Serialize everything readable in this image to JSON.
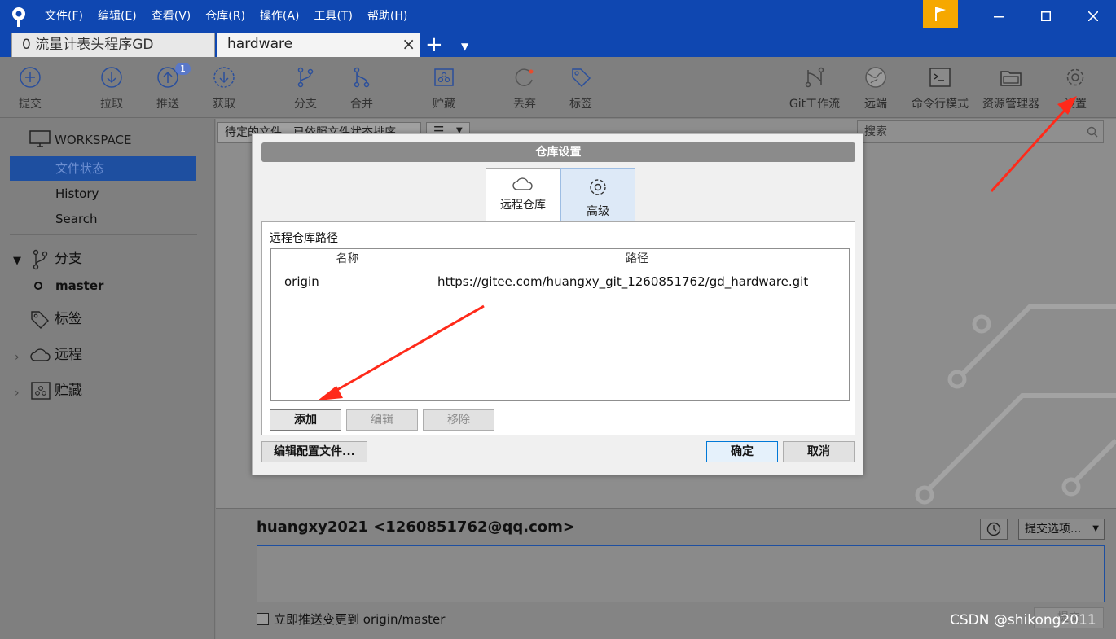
{
  "menus": [
    "文件(F)",
    "编辑(E)",
    "查看(V)",
    "仓库(R)",
    "操作(A)",
    "工具(T)",
    "帮助(H)"
  ],
  "tabs": [
    {
      "label": "0 流量计表头程序GD"
    },
    {
      "label": "hardware"
    }
  ],
  "toolbar": {
    "commit": "提交",
    "pull": "拉取",
    "push": "推送",
    "push_badge": "1",
    "fetch": "获取",
    "branch": "分支",
    "merge": "合并",
    "stash": "贮藏",
    "discard": "丢弃",
    "tag": "标签",
    "gitflow": "Git工作流",
    "remote": "远端",
    "terminal": "命令行模式",
    "explorer": "资源管理器",
    "settings": "设置"
  },
  "sidebar": {
    "workspace": "WORKSPACE",
    "file_status": "文件状态",
    "history": "History",
    "search": "Search",
    "branches": "分支",
    "master": "master",
    "tags": "标签",
    "remotes": "远程",
    "stashes": "贮藏"
  },
  "main": {
    "filter": "待定的文件，已依照文件状态排序",
    "search_placeholder": "搜索",
    "author": "huangxy2021 <1260851762@qq.com>",
    "commit_options": "提交选项...",
    "push_now": "立即推送变更到 origin/master",
    "commit_button": "提交"
  },
  "dialog": {
    "title": "仓库设置",
    "tab_remote": "远程仓库",
    "tab_advanced": "高级",
    "remote_path_label": "远程仓库路径",
    "columns": [
      "名称",
      "路径"
    ],
    "remotes": [
      {
        "name": "origin",
        "url": "https://gitee.com/huangxy_git_1260851762/gd_hardware.git"
      }
    ],
    "add": "添加",
    "edit": "编辑",
    "remove": "移除",
    "edit_config": "编辑配置文件...",
    "ok": "确定",
    "cancel": "取消"
  },
  "watermark": "CSDN @shikong2011",
  "colors": {
    "titlebar": "#0f47b1",
    "flag": "#f6a800",
    "selection": "#1e4fa0",
    "arrow": "#ff2a1a"
  }
}
